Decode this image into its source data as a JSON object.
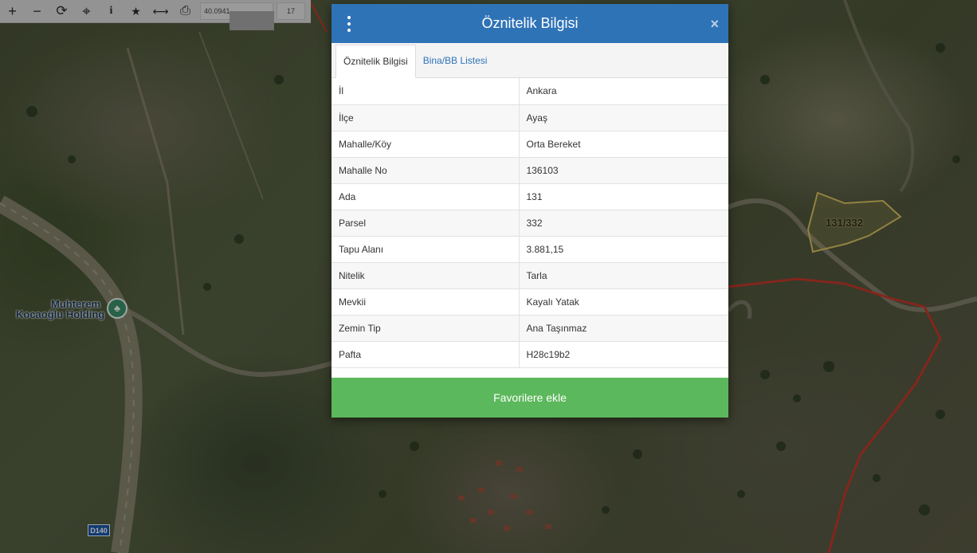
{
  "toolbar": {
    "tools": [
      {
        "icon": "plus-icon",
        "glyph": "+"
      },
      {
        "icon": "minus-icon",
        "glyph": "−"
      },
      {
        "icon": "refresh-icon",
        "glyph": "⟳"
      },
      {
        "icon": "crosshair-icon",
        "glyph": "⌖"
      },
      {
        "icon": "info-icon",
        "glyph": "i"
      },
      {
        "icon": "star-icon",
        "glyph": "★"
      },
      {
        "icon": "measure-icon",
        "glyph": "⟷"
      },
      {
        "icon": "print-icon",
        "glyph": "⎙"
      }
    ],
    "coordinate": "40.0941",
    "zoom": "17"
  },
  "map": {
    "poi_label_line1": "Muhterem",
    "poi_label_line2": "Kocaoğlu Holding",
    "road_shield": "D140",
    "parcel_label": "131/332"
  },
  "modal": {
    "title": "Öznitelik Bilgisi",
    "close_glyph": "×",
    "tabs": [
      {
        "label": "Öznitelik Bilgisi",
        "active": true
      },
      {
        "label": "Bina/BB Listesi",
        "active": false
      }
    ],
    "rows": [
      {
        "key": "İl",
        "value": "Ankara"
      },
      {
        "key": "İlçe",
        "value": "Ayaş"
      },
      {
        "key": "Mahalle/Köy",
        "value": "Orta Bereket"
      },
      {
        "key": "Mahalle No",
        "value": "136103"
      },
      {
        "key": "Ada",
        "value": "131"
      },
      {
        "key": "Parsel",
        "value": "332"
      },
      {
        "key": "Tapu Alanı",
        "value": "3.881,15"
      },
      {
        "key": "Nitelik",
        "value": "Tarla"
      },
      {
        "key": "Mevkii",
        "value": "Kayalı Yatak"
      },
      {
        "key": "Zemin Tip",
        "value": "Ana Taşınmaz"
      },
      {
        "key": "Pafta",
        "value": "H28c19b2"
      }
    ],
    "button_label": "Favorilere ekle"
  },
  "colors": {
    "header_blue": "#2f73b7",
    "button_green": "#5cb85c",
    "boundary_red": "#c0392b",
    "parcel_outline": "#d8c060"
  }
}
